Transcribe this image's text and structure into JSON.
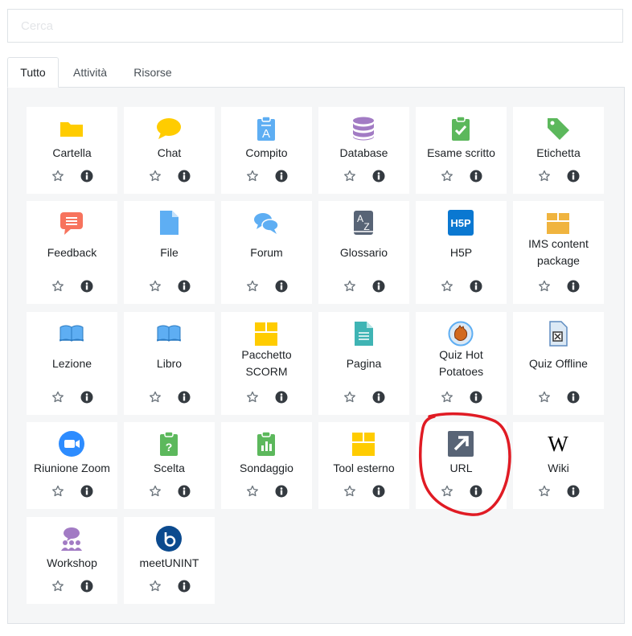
{
  "search": {
    "placeholder": "Cerca"
  },
  "tabs": [
    {
      "label": "Tutto",
      "active": true
    },
    {
      "label": "Attività",
      "active": false
    },
    {
      "label": "Risorse",
      "active": false
    }
  ],
  "modules": [
    {
      "label": "Cartella",
      "icon": "folder-icon"
    },
    {
      "label": "Chat",
      "icon": "chat-icon"
    },
    {
      "label": "Compito",
      "icon": "assignment-icon"
    },
    {
      "label": "Database",
      "icon": "database-icon"
    },
    {
      "label": "Esame scritto",
      "icon": "exam-icon"
    },
    {
      "label": "Etichetta",
      "icon": "label-icon"
    },
    {
      "label": "Feedback",
      "icon": "feedback-icon"
    },
    {
      "label": "File",
      "icon": "file-icon"
    },
    {
      "label": "Forum",
      "icon": "forum-icon"
    },
    {
      "label": "Glossario",
      "icon": "glossary-icon"
    },
    {
      "label": "H5P",
      "icon": "h5p-icon"
    },
    {
      "label": "IMS content package",
      "icon": "ims-package-icon"
    },
    {
      "label": "Lezione",
      "icon": "lesson-icon"
    },
    {
      "label": "Libro",
      "icon": "book-icon"
    },
    {
      "label": "Pacchetto SCORM",
      "icon": "scorm-icon"
    },
    {
      "label": "Pagina",
      "icon": "page-icon"
    },
    {
      "label": "Quiz Hot Potatoes",
      "icon": "hot-potatoes-icon"
    },
    {
      "label": "Quiz Offline",
      "icon": "offline-quiz-icon"
    },
    {
      "label": "Riunione Zoom",
      "icon": "zoom-icon"
    },
    {
      "label": "Scelta",
      "icon": "choice-icon"
    },
    {
      "label": "Sondaggio",
      "icon": "survey-icon"
    },
    {
      "label": "Tool esterno",
      "icon": "external-tool-icon"
    },
    {
      "label": "URL",
      "icon": "url-icon"
    },
    {
      "label": "Wiki",
      "icon": "wiki-icon"
    },
    {
      "label": "Workshop",
      "icon": "workshop-icon"
    },
    {
      "label": "meetUNINT",
      "icon": "meetunint-icon"
    }
  ],
  "colors": {
    "folder": "#ffcc00",
    "blue": "#5eaef3",
    "purple": "#a27bc4",
    "green": "#5cb85c",
    "coral": "#f7735d",
    "slate": "#586476",
    "amber": "#f0b43f",
    "teal": "#3fb4b4",
    "zoom": "#2d8cff",
    "annotation": "#e01b24"
  }
}
